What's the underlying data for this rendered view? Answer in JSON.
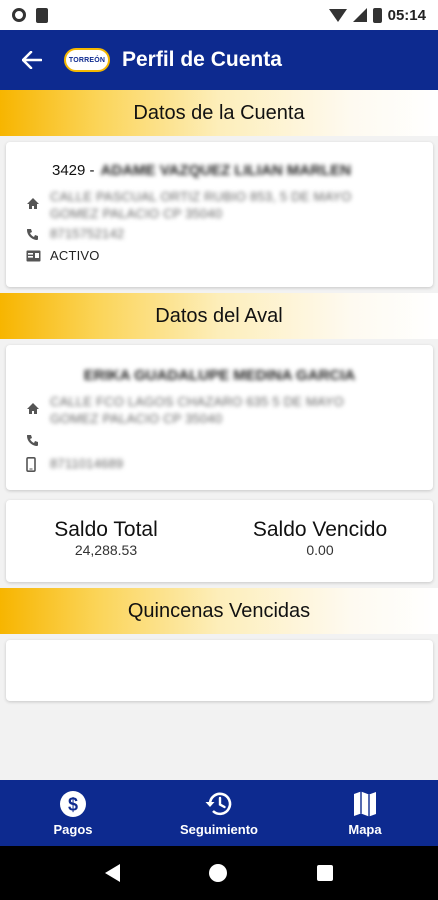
{
  "status_bar": {
    "time": "05:14"
  },
  "app_bar": {
    "title": "Perfil de Cuenta",
    "logo_text": "TORREÓN"
  },
  "cuenta": {
    "header": "Datos de la Cuenta",
    "id": "3429 -",
    "name": "ADAME VAZQUEZ LILIAN MARLEN",
    "address_line1": "CALLE PASCUAL ORTIZ RUBIO 853, 5 DE MAYO",
    "address_line2": "GOMEZ PALACIO CP 35040",
    "phone": "8715752142",
    "status": "ACTIVO"
  },
  "aval": {
    "header": "Datos del Aval",
    "name": "ERIKA GUADALUPE MEDINA GARCIA",
    "address_line1": "CALLE FCO LAGOS CHAZARO 635 5 DE MAYO",
    "address_line2": "GOMEZ PALACIO CP 35040",
    "phone": "",
    "mobile": "8711014689"
  },
  "saldos": {
    "total_label": "Saldo Total",
    "total_value": "24,288.53",
    "vencido_label": "Saldo Vencido",
    "vencido_value": "0.00"
  },
  "quincenas": {
    "header": "Quincenas Vencidas"
  },
  "bottom_nav": [
    {
      "label": "Pagos",
      "icon": "dollar-circle-icon"
    },
    {
      "label": "Seguimiento",
      "icon": "history-icon"
    },
    {
      "label": "Mapa",
      "icon": "map-icon"
    }
  ],
  "colors": {
    "primary": "#0d2a8f",
    "accent": "#f7b500"
  }
}
